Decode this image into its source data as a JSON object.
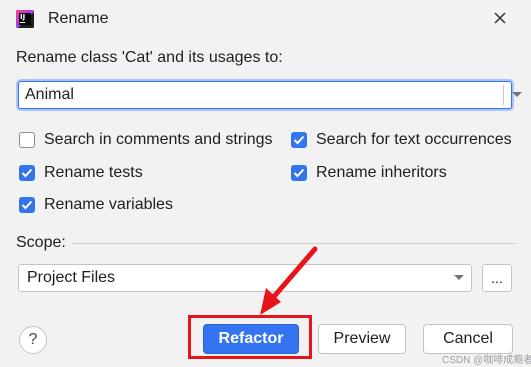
{
  "dialog": {
    "title": "Rename",
    "app_icon": "intellij-idea-icon",
    "close_icon": "close-icon"
  },
  "prompt": "Rename class 'Cat' and its usages to:",
  "name_field": {
    "value": "Animal",
    "dropdown_icon": "chevron-down-icon"
  },
  "options": {
    "search_comments": {
      "label": "Search in comments and strings",
      "checked": false
    },
    "search_text": {
      "label": "Search for text occurrences",
      "checked": true
    },
    "rename_tests": {
      "label": "Rename tests",
      "checked": true
    },
    "rename_inheritors": {
      "label": "Rename inheritors",
      "checked": true
    },
    "rename_variables": {
      "label": "Rename variables",
      "checked": true
    }
  },
  "scope": {
    "label": "Scope:",
    "value": "Project Files",
    "browse_label": "..."
  },
  "buttons": {
    "help": "?",
    "refactor": "Refactor",
    "preview": "Preview",
    "cancel": "Cancel"
  },
  "colors": {
    "accent": "#3574f0",
    "annotation": "#e8131b"
  },
  "watermark": "CSDN @咖啡成瘾者"
}
